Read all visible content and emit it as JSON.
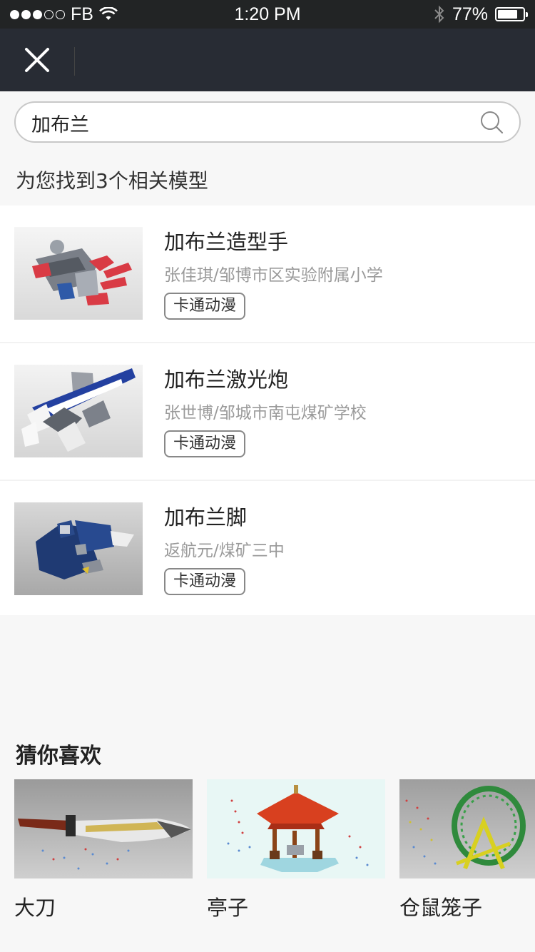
{
  "status_bar": {
    "carrier": "FB",
    "time": "1:20 PM",
    "battery": "77%",
    "battery_level": 0.77
  },
  "nav": {
    "close_icon": "close-icon"
  },
  "search": {
    "value": "加布兰",
    "icon": "search-icon"
  },
  "result_summary": "为您找到3个相关模型",
  "results": [
    {
      "title": "加布兰造型手",
      "author": "张佳琪/邹博市区实验附属小学",
      "tag": "卡通动漫"
    },
    {
      "title": "加布兰激光炮",
      "author": "张世博/邹城市南屯煤矿学校",
      "tag": "卡通动漫"
    },
    {
      "title": "加布兰脚",
      "author": "返航元/煤矿三中",
      "tag": "卡通动漫"
    }
  ],
  "recommendations": {
    "title": "猜你喜欢",
    "items": [
      {
        "label": "大刀"
      },
      {
        "label": "亭子"
      },
      {
        "label": "仓鼠笼子"
      }
    ]
  },
  "colors": {
    "status_bar_bg": "#222425",
    "nav_bg": "#282c34",
    "page_bg": "#f7f7f7",
    "muted_text": "#9a9a9a"
  }
}
